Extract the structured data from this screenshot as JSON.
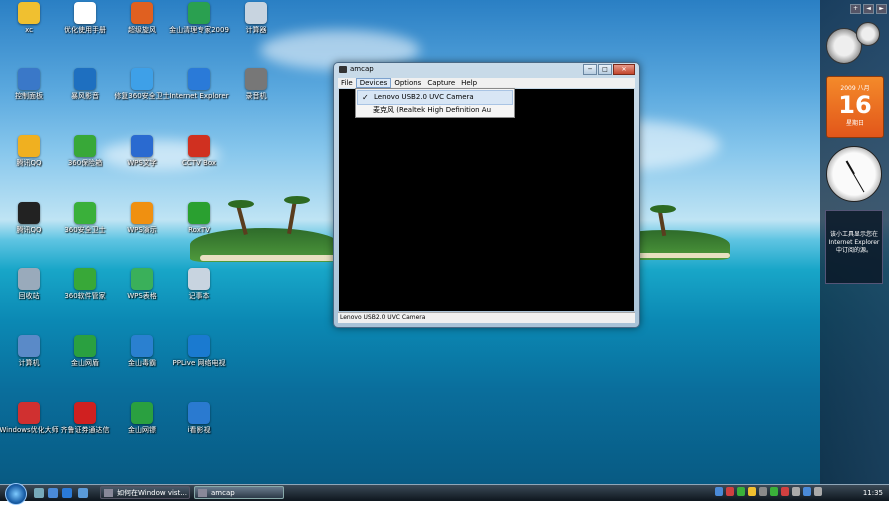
{
  "desktop_icons": [
    {
      "label": "xc",
      "color": "#f0c030"
    },
    {
      "label": "优化使用手册",
      "color": "#ffffff"
    },
    {
      "label": "超级旋风",
      "color": "#e06020"
    },
    {
      "label": "金山清理专家2009",
      "color": "#2aa050"
    },
    {
      "label": "计算器",
      "color": "#c8d4e0"
    },
    {
      "label": "控制面板",
      "color": "#3a78c8"
    },
    {
      "label": "暴风影音",
      "color": "#1e6fc0"
    },
    {
      "label": "修复360安全卫士",
      "color": "#3ea0e8"
    },
    {
      "label": "Internet Explorer",
      "color": "#2a7ad8"
    },
    {
      "label": "录音机",
      "color": "#777777"
    },
    {
      "label": "腾讯QQ",
      "color": "#f0b020"
    },
    {
      "label": "360保险箱",
      "color": "#38a838"
    },
    {
      "label": "WPS文字",
      "color": "#2a6ad0"
    },
    {
      "label": "CCTV Box",
      "color": "#d03020"
    },
    {
      "label": "腾讯QQ",
      "color": "#222222"
    },
    {
      "label": "360安全卫士",
      "color": "#3ab03a"
    },
    {
      "label": "WPS演示",
      "color": "#f09010"
    },
    {
      "label": "RoxTV",
      "color": "#2aa030"
    },
    {
      "label": "回收站",
      "color": "#9ab"
    },
    {
      "label": "360软件管家",
      "color": "#38a838"
    },
    {
      "label": "WPS表格",
      "color": "#3ab05a"
    },
    {
      "label": "记事本",
      "color": "#c8d4e0"
    },
    {
      "label": "计算机",
      "color": "#5a8ac8"
    },
    {
      "label": "金山网盾",
      "color": "#2aa040"
    },
    {
      "label": "金山毒霸",
      "color": "#2a80d0"
    },
    {
      "label": "PPLive 网络电视",
      "color": "#1a7ad0"
    },
    {
      "label": "Windows优化大师",
      "color": "#d03030"
    },
    {
      "label": "齐鲁证券通达信",
      "color": "#d02020"
    },
    {
      "label": "金山网镖",
      "color": "#2aa040"
    },
    {
      "label": "i看影视",
      "color": "#2a7ad0"
    }
  ],
  "window": {
    "title": "amcap",
    "menu": [
      "File",
      "Devices",
      "Options",
      "Capture",
      "Help"
    ],
    "status": "Lenovo USB2.0 UVC Camera",
    "dropdown": {
      "items": [
        {
          "label": "Lenovo USB2.0 UVC Camera",
          "checked": true
        },
        {
          "label": "麦克风 (Realtek High Definition Au",
          "checked": false
        }
      ],
      "check_glyph": "✓"
    },
    "buttons": {
      "minimize": "─",
      "maximize": "□",
      "close": "✕"
    }
  },
  "sidebar": {
    "controls": [
      "+",
      "◄",
      "►"
    ],
    "calendar": {
      "month": "2009 八月",
      "day": "16",
      "weekday": "星期日"
    },
    "gadget_text": "该小工具显示您在 Internet Explorer 中订阅的源。"
  },
  "taskbar": {
    "tasks": [
      {
        "label": "如何在Window vist...",
        "active": false
      },
      {
        "label": "amcap",
        "active": true
      }
    ],
    "time": "11:35",
    "tray_colors": [
      "#4a8ad8",
      "#d04040",
      "#3ab03a",
      "#f0c030",
      "#8a8a8a",
      "#3ab03a",
      "#d04040",
      "#aaaaaa",
      "#4a8ad8",
      "#aaaaaa"
    ]
  }
}
